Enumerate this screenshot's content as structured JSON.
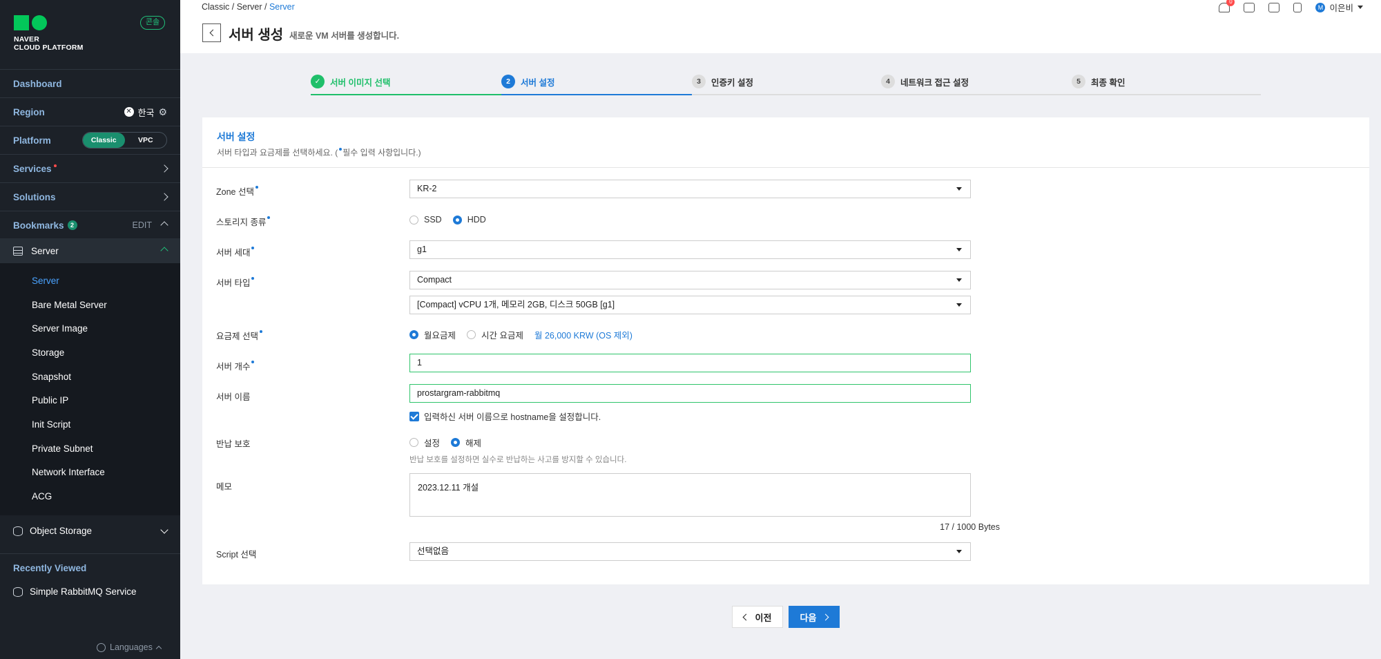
{
  "brand": {
    "line1": "NAVER",
    "line2": "CLOUD PLATFORM",
    "badge": "콘솔"
  },
  "sidebar": {
    "dashboard": "Dashboard",
    "region_label": "Region",
    "region_value": "한국",
    "platform_label": "Platform",
    "platform_options": [
      "Classic",
      "VPC"
    ],
    "services": "Services",
    "solutions": "Solutions",
    "bookmarks": "Bookmarks",
    "bookmarks_count": "2",
    "bookmarks_edit": "EDIT",
    "server": "Server",
    "server_items": [
      "Server",
      "Bare Metal Server",
      "Server Image",
      "Storage",
      "Snapshot",
      "Public IP",
      "Init Script",
      "Private Subnet",
      "Network Interface",
      "ACG"
    ],
    "object_storage": "Object Storage",
    "recently_viewed": "Recently Viewed",
    "recent_item": "Simple RabbitMQ Service",
    "languages": "Languages"
  },
  "header": {
    "breadcrumb": [
      "Classic",
      "Server",
      "Server"
    ],
    "title": "서버 생성",
    "subtitle": "새로운 VM 서버를 생성합니다.",
    "notif_count": "0",
    "user_initial": "M",
    "user_name": "이은비"
  },
  "steps": [
    {
      "num": "1",
      "label": "서버 이미지 선택"
    },
    {
      "num": "2",
      "label": "서버 설정"
    },
    {
      "num": "3",
      "label": "인증키 설정"
    },
    {
      "num": "4",
      "label": "네트워크 접근 설정"
    },
    {
      "num": "5",
      "label": "최종 확인"
    }
  ],
  "form": {
    "section_title": "서버 설정",
    "section_desc_pre": "서버 타입과 요금제를 선택하세요. (",
    "section_desc_post": "필수 입력 사항입니다.)",
    "zone_label": "Zone 선택",
    "zone_value": "KR-2",
    "storage_label": "스토리지 종류",
    "storage_options": [
      "SSD",
      "HDD"
    ],
    "gen_label": "서버 세대",
    "gen_value": "g1",
    "type_label": "서버 타입",
    "type_value": "Compact",
    "spec_value": "[Compact] vCPU 1개, 메모리 2GB, 디스크 50GB [g1]",
    "plan_label": "요금제 선택",
    "plan_options": [
      "월요금제",
      "시간 요금제"
    ],
    "plan_price": "월 26,000 KRW (OS 제외)",
    "count_label": "서버 개수",
    "count_value": "1",
    "name_label": "서버 이름",
    "name_value": "prostargram-rabbitmq",
    "hostname_check": "입력하신 서버 이름으로 hostname을 설정합니다.",
    "protect_label": "반납 보호",
    "protect_options": [
      "설정",
      "해제"
    ],
    "protect_hint": "반납 보호를 설정하면 실수로 반납하는 사고를 방지할 수 있습니다.",
    "memo_label": "메모",
    "memo_value": "2023.12.11 개설",
    "memo_bytes": "17 / 1000 Bytes",
    "script_label": "Script 선택",
    "script_value": "선택없음"
  },
  "buttons": {
    "prev": "이전",
    "next": "다음"
  },
  "colors": {
    "accent": "#1e7ad7",
    "success": "#1fbf6a",
    "sidebar": "#1c2128"
  }
}
